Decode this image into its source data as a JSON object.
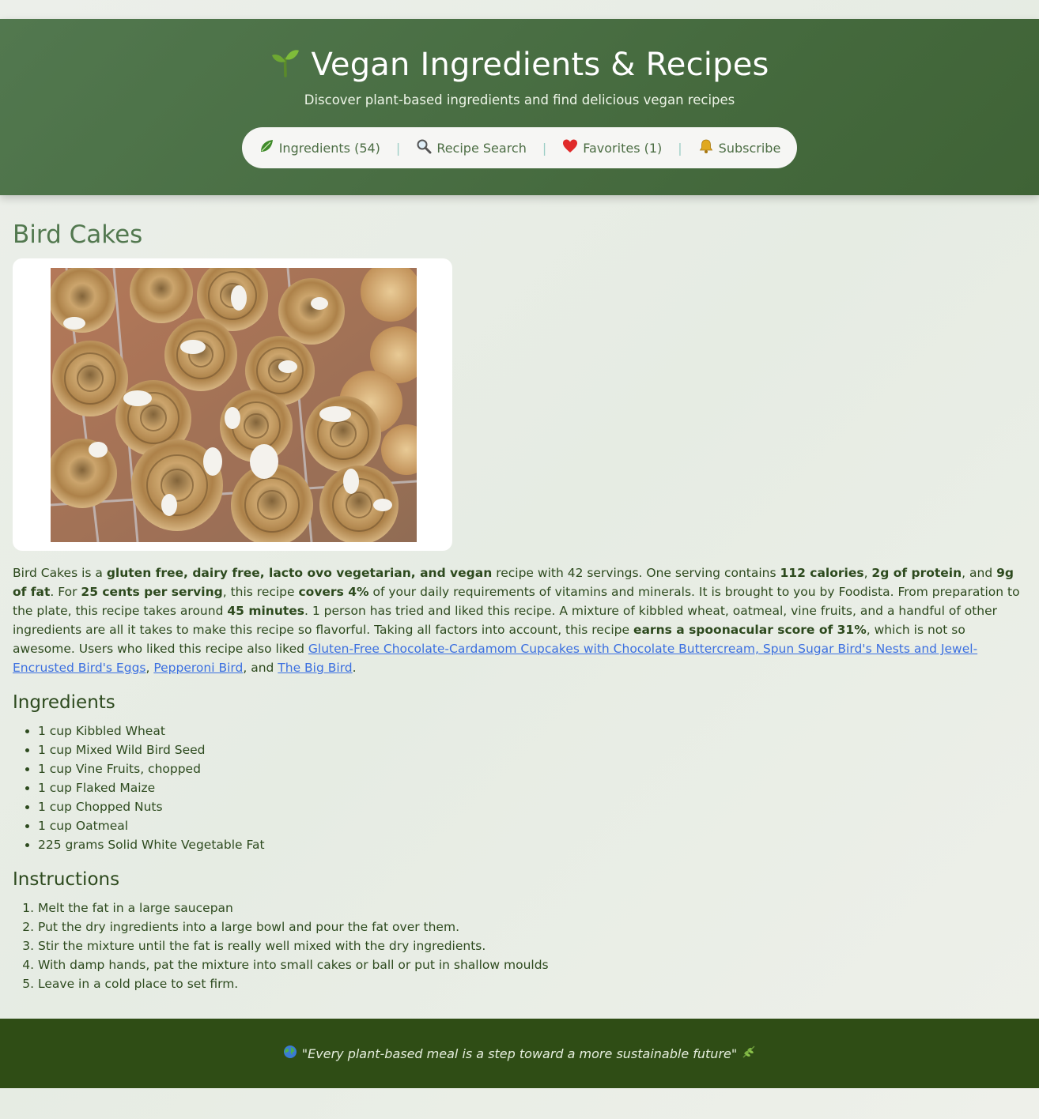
{
  "header": {
    "title": "Vegan Ingredients & Recipes",
    "title_icon": "seedling-icon",
    "subtitle": "Discover plant-based ingredients and find delicious vegan recipes"
  },
  "nav": {
    "items": [
      {
        "label": "Ingredients (54)",
        "icon": "leaf-icon"
      },
      {
        "label": "Recipe Search",
        "icon": "magnifier-icon"
      },
      {
        "label": "Favorites (1)",
        "icon": "heart-icon"
      },
      {
        "label": "Subscribe",
        "icon": "bell-icon"
      }
    ],
    "separator": "|"
  },
  "recipe": {
    "title": "Bird Cakes",
    "image_alt": "Bird Cakes",
    "summary": {
      "s1": "Bird Cakes is a ",
      "b1": "gluten free, dairy free, lacto ovo vegetarian, and vegan",
      "s2": " recipe with 42 servings. One serving contains ",
      "b2": "112 calories",
      "s3": ", ",
      "b3": "2g of protein",
      "s4": ", and ",
      "b4": "9g of fat",
      "s5": ". For ",
      "b5": "25 cents per serving",
      "s6": ", this recipe ",
      "b6": "covers 4%",
      "s7": " of your daily requirements of vitamins and minerals. It is brought to you by Foodista. From preparation to the plate, this recipe takes around ",
      "b7": "45 minutes",
      "s8": ". 1 person has tried and liked this recipe. A mixture of kibbled wheat, oatmeal, vine fruits, and a handful of other ingredients are all it takes to make this recipe so flavorful. Taking all factors into account, this recipe ",
      "b8": "earns a spoonacular score of 31%",
      "s9": ", which is not so awesome. Users who liked this recipe also liked ",
      "link1": "Gluten-Free Chocolate-Cardamom Cupcakes with Chocolate Buttercream, Spun Sugar Bird's Nests and Jewel-Encrusted Bird's Eggs",
      "s10": ", ",
      "link2": "Pepperoni Bird",
      "s11": ", and ",
      "link3": "The Big Bird",
      "s12": "."
    },
    "ingredients_heading": "Ingredients",
    "ingredients": [
      "1 cup Kibbled Wheat",
      "1 cup Mixed Wild Bird Seed",
      "1 cup Vine Fruits, chopped",
      "1 cup Flaked Maize",
      "1 cup Chopped Nuts",
      "1 cup Oatmeal",
      "225 grams Solid White Vegetable Fat"
    ],
    "instructions_heading": "Instructions",
    "instructions": [
      "Melt the fat in a large saucepan",
      "Put the dry ingredients into a large bowl and pour the fat over them.",
      "Stir the mixture until the fat is really well mixed with the dry ingredients.",
      "With damp hands, pat the mixture into small cakes or ball or put in shallow moulds",
      "Leave in a cold place to set firm."
    ]
  },
  "footer": {
    "quote": "\"Every plant-based meal is a step toward a more sustainable future\"",
    "left_icon": "globe-icon",
    "right_icon": "herb-icon"
  },
  "colors": {
    "header_green": "#4a6e43",
    "title_green": "#52784f",
    "text_dark_green": "#2d4a1e",
    "footer_green": "#2f4d15",
    "link_blue": "#3b6fe0",
    "nav_separator": "#9ccdc5"
  }
}
